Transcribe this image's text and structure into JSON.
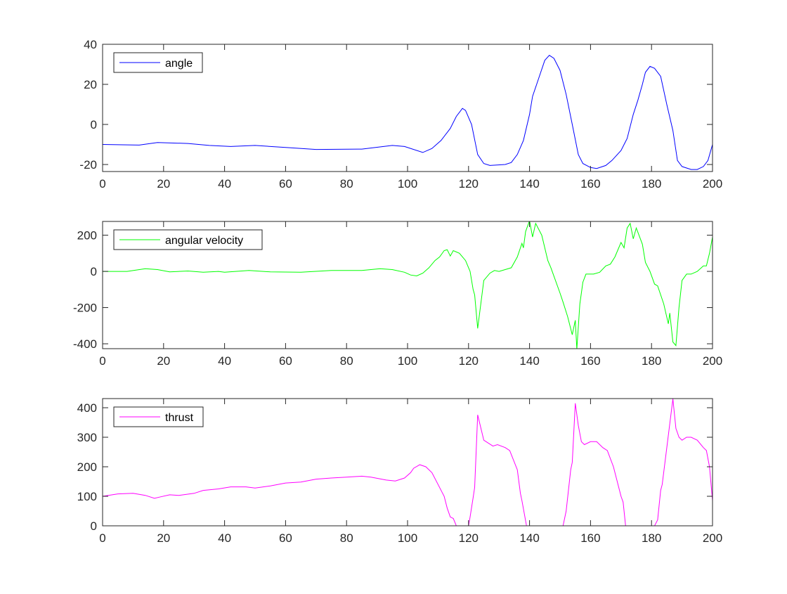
{
  "chart_data": [
    {
      "type": "line",
      "xlim": [
        0,
        200
      ],
      "ylim": [
        -23.5,
        40
      ],
      "xticks": [
        0,
        20,
        40,
        60,
        80,
        100,
        120,
        140,
        160,
        180,
        200
      ],
      "yticks": [
        -20,
        0,
        20,
        40
      ],
      "legend_placement": "top-left",
      "grid": false,
      "series": [
        {
          "name": "angle",
          "color": "#0000ff",
          "x": [
            0,
            12,
            18,
            28,
            35,
            42,
            50,
            60,
            70,
            85,
            95,
            99,
            105,
            108,
            111,
            114,
            116,
            118,
            119,
            121,
            123,
            125,
            127,
            132,
            134,
            136,
            138,
            140,
            141,
            143,
            145,
            146.5,
            148,
            150,
            152,
            154,
            156,
            157.5,
            160,
            162,
            165,
            167,
            170,
            172,
            174,
            175.5,
            177,
            178,
            179.5,
            181,
            183,
            185,
            187,
            188.5,
            190,
            193,
            195,
            197,
            198.5,
            200
          ],
          "y": [
            -10,
            -10.3,
            -9,
            -9.5,
            -10.5,
            -11,
            -10.5,
            -11.5,
            -12.5,
            -12.3,
            -10.5,
            -11,
            -14,
            -12,
            -8,
            -2,
            4,
            8,
            7,
            0,
            -15,
            -19.5,
            -20.5,
            -20,
            -19,
            -15,
            -8,
            5,
            14,
            23,
            32,
            34.5,
            33,
            27,
            15,
            0,
            -15,
            -19.5,
            -21.5,
            -22,
            -20.5,
            -18,
            -13,
            -7,
            5,
            12,
            20,
            26,
            29,
            28,
            24,
            10,
            -3,
            -18,
            -21,
            -22.5,
            -22.5,
            -21,
            -18,
            -10
          ]
        }
      ]
    },
    {
      "type": "line",
      "xlim": [
        0,
        200
      ],
      "ylim": [
        -427,
        276
      ],
      "xticks": [
        0,
        20,
        40,
        60,
        80,
        100,
        120,
        140,
        160,
        180,
        200
      ],
      "yticks": [
        -400,
        -200,
        0,
        200
      ],
      "legend_placement": "top-left",
      "grid": false,
      "series": [
        {
          "name": "angular velocity",
          "color": "#00ff00",
          "x": [
            0,
            8,
            14,
            18,
            22,
            28,
            33,
            38,
            40,
            48,
            55,
            65,
            75,
            85,
            91,
            95,
            99,
            101,
            103,
            105,
            107,
            109,
            110.5,
            112,
            113,
            114,
            115,
            117,
            119,
            120.5,
            121.5,
            122,
            123,
            125,
            127,
            128.5,
            130,
            132,
            134,
            136,
            137.5,
            138,
            138.7,
            140,
            141,
            142,
            144,
            146,
            147,
            150,
            151,
            152.5,
            154,
            155,
            155.5,
            156.5,
            157.5,
            158.5,
            161,
            163,
            165,
            166.5,
            168,
            170,
            171,
            172,
            173,
            174,
            175,
            177,
            178,
            179.5,
            181,
            182,
            184,
            185.5,
            186,
            187,
            188,
            189,
            190,
            191.5,
            193,
            195,
            197,
            198,
            199,
            200
          ],
          "y": [
            0,
            0,
            15,
            10,
            -3,
            2,
            -5,
            0,
            -5,
            5,
            -3,
            -5,
            5,
            5,
            15,
            10,
            -5,
            -20,
            -25,
            -10,
            20,
            60,
            80,
            115,
            120,
            85,
            115,
            100,
            60,
            0,
            -100,
            -130,
            -315,
            -50,
            -10,
            5,
            0,
            10,
            20,
            80,
            155,
            130,
            220,
            280,
            190,
            265,
            200,
            60,
            20,
            -120,
            -170,
            -250,
            -350,
            -270,
            -430,
            -180,
            -60,
            -15,
            -15,
            -5,
            30,
            40,
            80,
            160,
            130,
            240,
            265,
            180,
            240,
            150,
            50,
            0,
            -70,
            -80,
            -180,
            -290,
            -230,
            -390,
            -410,
            -200,
            -50,
            -15,
            -15,
            0,
            30,
            30,
            100,
            190
          ]
        }
      ]
    },
    {
      "type": "line",
      "xlim": [
        0,
        200
      ],
      "ylim": [
        0,
        431
      ],
      "xticks": [
        0,
        20,
        40,
        60,
        80,
        100,
        120,
        140,
        160,
        180,
        200
      ],
      "yticks": [
        0,
        100,
        200,
        300,
        400
      ],
      "legend_placement": "top-left",
      "grid": false,
      "series": [
        {
          "name": "thrust",
          "color": "#ff00ff",
          "x": [
            0,
            5,
            10,
            14,
            17,
            19,
            22,
            25,
            30,
            33,
            38,
            42,
            47,
            50,
            55,
            60,
            65,
            70,
            75,
            80,
            85,
            88,
            93,
            96,
            99,
            101,
            102,
            104,
            106,
            108,
            110,
            111.5,
            112,
            113,
            114,
            115,
            116,
            120,
            120.5,
            121.5,
            122,
            123,
            125,
            128,
            129.5,
            132,
            133.5,
            136,
            137,
            137.5,
            139,
            151,
            152,
            153.5,
            154,
            155,
            156,
            157,
            158,
            160,
            162,
            164,
            165.5,
            167.5,
            170,
            170.7,
            171.5,
            181,
            182,
            183,
            183.5,
            187,
            188,
            189,
            190,
            191.5,
            193,
            195,
            197,
            198,
            199,
            200
          ],
          "y": [
            100,
            108,
            110,
            103,
            93,
            98,
            105,
            103,
            110,
            120,
            125,
            132,
            132,
            128,
            135,
            145,
            148,
            158,
            162,
            165,
            168,
            165,
            155,
            152,
            162,
            180,
            195,
            207,
            200,
            180,
            140,
            110,
            100,
            60,
            30,
            25,
            0,
            0,
            30,
            95,
            130,
            376,
            290,
            270,
            275,
            265,
            255,
            190,
            110,
            85,
            0,
            0,
            50,
            190,
            215,
            415,
            340,
            285,
            275,
            285,
            285,
            265,
            255,
            200,
            100,
            80,
            0,
            0,
            20,
            120,
            140,
            430,
            330,
            300,
            290,
            300,
            300,
            290,
            265,
            255,
            200,
            85
          ]
        }
      ]
    }
  ]
}
